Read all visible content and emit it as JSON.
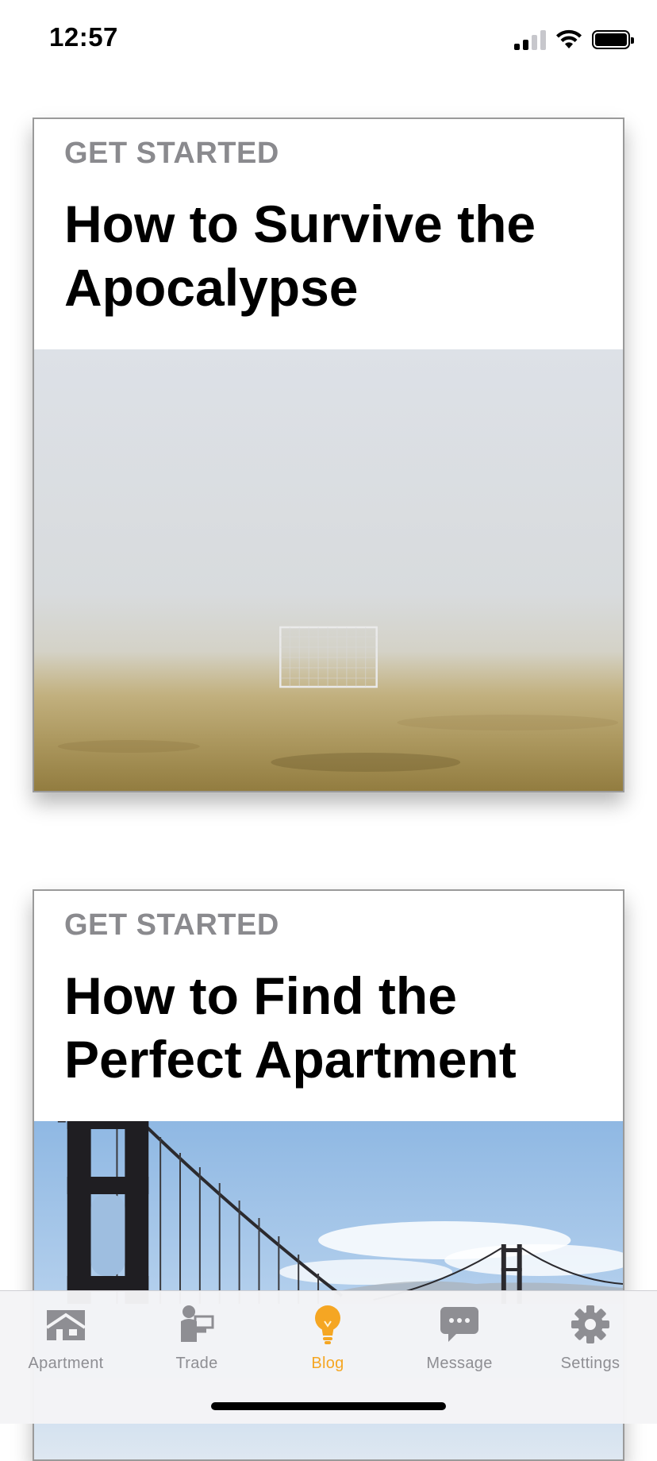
{
  "status_bar": {
    "time": "12:57"
  },
  "posts": [
    {
      "category": "GET STARTED",
      "title": "How to Survive the Apocalypse"
    },
    {
      "category": "GET STARTED",
      "title": "How to Find the Perfect Apartment"
    }
  ],
  "tab_bar": {
    "items": [
      {
        "label": "Apartment",
        "icon": "house-icon"
      },
      {
        "label": "Trade",
        "icon": "trade-icon"
      },
      {
        "label": "Blog",
        "icon": "lightbulb-icon"
      },
      {
        "label": "Message",
        "icon": "chat-bubble-icon"
      },
      {
        "label": "Settings",
        "icon": "gear-icon"
      }
    ],
    "active": "Blog",
    "active_color": "#f5a623",
    "inactive_color": "#8e8e93"
  }
}
